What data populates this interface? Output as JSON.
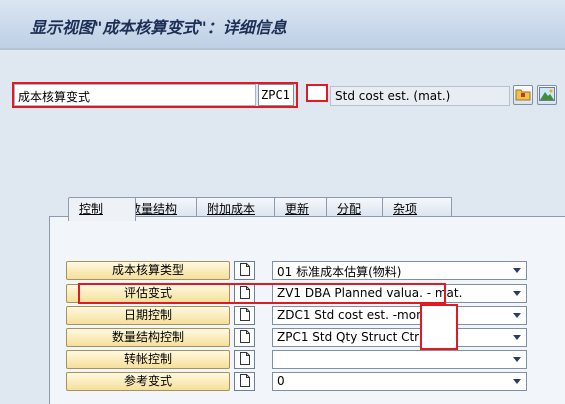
{
  "screen": {
    "title": "显示视图\"成本核算变式\"：详细信息"
  },
  "header": {
    "field_label": "成本核算变式",
    "field_value": "ZPC1",
    "description": "Std cost est. (mat.)"
  },
  "tabs": [
    {
      "label": "控制"
    },
    {
      "label": "数量结构"
    },
    {
      "label": "附加成本"
    },
    {
      "label": "更新"
    },
    {
      "label": "分配"
    },
    {
      "label": "杂项"
    }
  ],
  "rows": [
    {
      "label": "成本核算类型",
      "value": "01 标准成本估算(物料)"
    },
    {
      "label": "评估变式",
      "value": "ZV1 DBA Planned valua. - mat."
    },
    {
      "label": "日期控制",
      "value": "ZDC1 Std cost est. -month"
    },
    {
      "label": "数量结构控制",
      "value": "ZPC1 Std Qty Struct Ctrl ("
    },
    {
      "label": "转帐控制",
      "value": ""
    },
    {
      "label": "参考变式",
      "value": "0"
    }
  ],
  "icons": {
    "folder": "folder-icon",
    "mountain": "mountain-image-icon",
    "page": "page-icon",
    "dropdown": "chevron-down-icon"
  },
  "colors": {
    "highlight": "#e01a24",
    "title_text": "#1d2f55",
    "button_face": "#f5e09a"
  }
}
